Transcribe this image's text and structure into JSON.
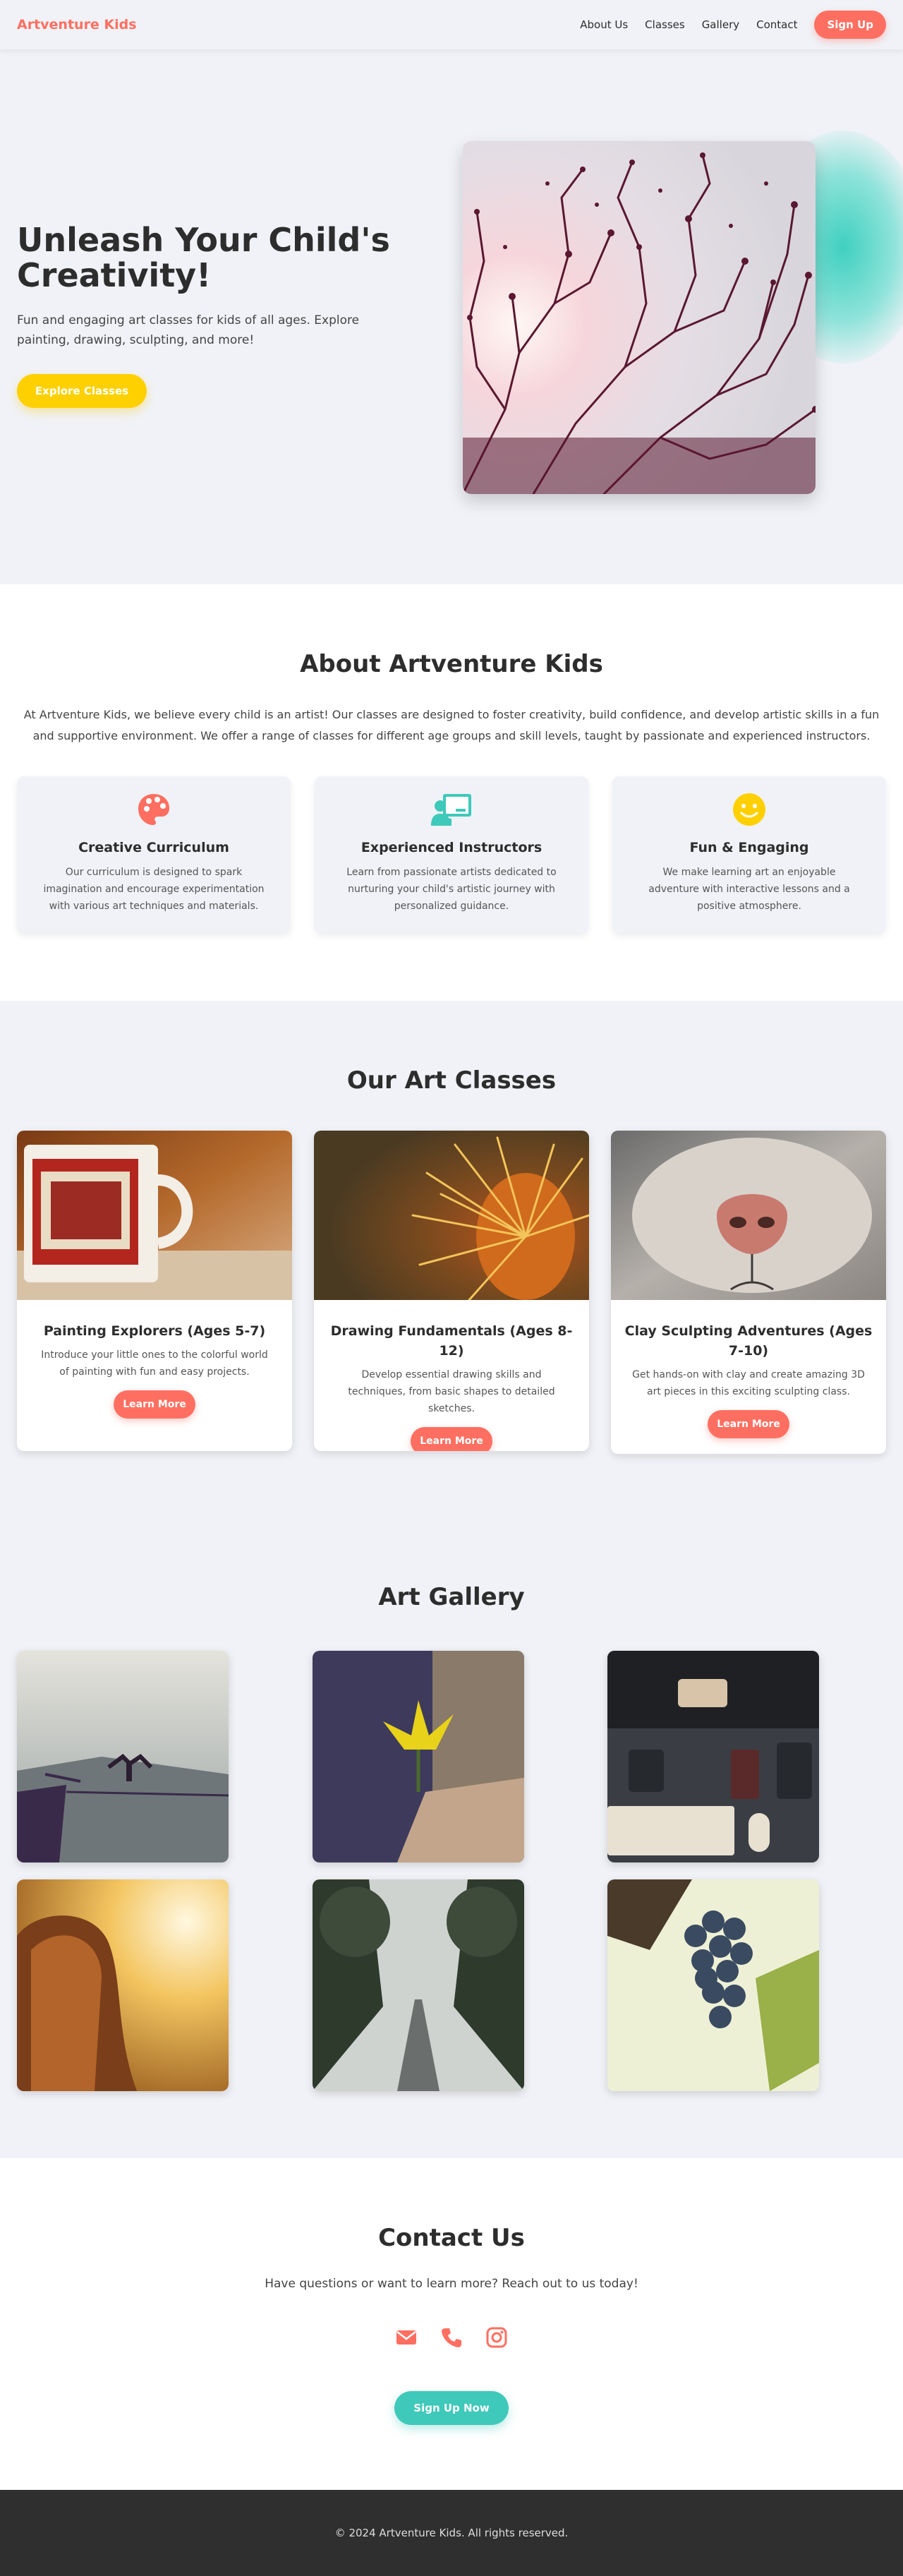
{
  "nav": {
    "logo": "Artventure Kids",
    "links": [
      "About Us",
      "Classes",
      "Gallery",
      "Contact"
    ],
    "cta": "Sign Up"
  },
  "hero": {
    "title": "Unleash Your Child's Creativity!",
    "subtitle": "Fun and engaging art classes for kids of all ages. Explore painting, drawing, sculpting, and more!",
    "button": "Explore Classes",
    "image": "silhouette-branches-photo"
  },
  "about": {
    "title": "About Artventure Kids",
    "text": "At Artventure Kids, we believe every child is an artist! Our classes are designed to foster creativity, build confidence, and develop artistic skills in a fun and supportive environment. We offer a range of classes for different age groups and skill levels, taught by passionate and experienced instructors.",
    "features": [
      {
        "icon": "palette-icon",
        "title": "Creative Curriculum",
        "desc": "Our curriculum is designed to spark imagination and encourage experimentation with various art techniques and materials."
      },
      {
        "icon": "chalkboard-teacher-icon",
        "title": "Experienced Instructors",
        "desc": "Learn from passionate artists dedicated to nurturing your child's artistic journey with personalized guidance."
      },
      {
        "icon": "smile-icon",
        "title": "Fun & Engaging",
        "desc": "We make learning art an enjoyable adventure with interactive lessons and a positive atmosphere."
      }
    ]
  },
  "classes": {
    "title": "Our Art Classes",
    "items": [
      {
        "title": "Painting Explorers (Ages 5-7)",
        "desc": "Introduce your little ones to the colorful world of painting with fun and easy projects.",
        "button": "Learn More",
        "image": "vintage-mug-photo"
      },
      {
        "title": "Drawing Fundamentals (Ages 8-12)",
        "desc": "Develop essential drawing skills and techniques, from basic shapes to detailed sketches.",
        "button": "Learn More",
        "image": "cactus-spines-photo"
      },
      {
        "title": "Clay Sculpting Adventures (Ages 7-10)",
        "desc": "Get hands-on with clay and create amazing 3D art pieces in this exciting sculpting class.",
        "button": "Learn More",
        "image": "cat-nose-photo"
      }
    ]
  },
  "gallery": {
    "title": "Art Gallery",
    "images": [
      "lake-bird-photo",
      "yellow-plant-photo",
      "desk-setup-photo",
      "sunset-girl-photo",
      "foggy-road-photo",
      "grapes-photo"
    ]
  },
  "contact": {
    "title": "Contact Us",
    "text": "Have questions or want to learn more? Reach out to us today!",
    "icons": [
      "envelope-icon",
      "phone-icon",
      "instagram-icon"
    ],
    "button": "Sign Up Now"
  },
  "footer": {
    "text": "© 2024 Artventure Kids. All rights reserved."
  },
  "colors": {
    "accent": "#ff6f61",
    "yellow": "#ffd000",
    "teal": "#3ec9ba",
    "background": "#f0f2f7",
    "footer": "#2f2f2f"
  }
}
